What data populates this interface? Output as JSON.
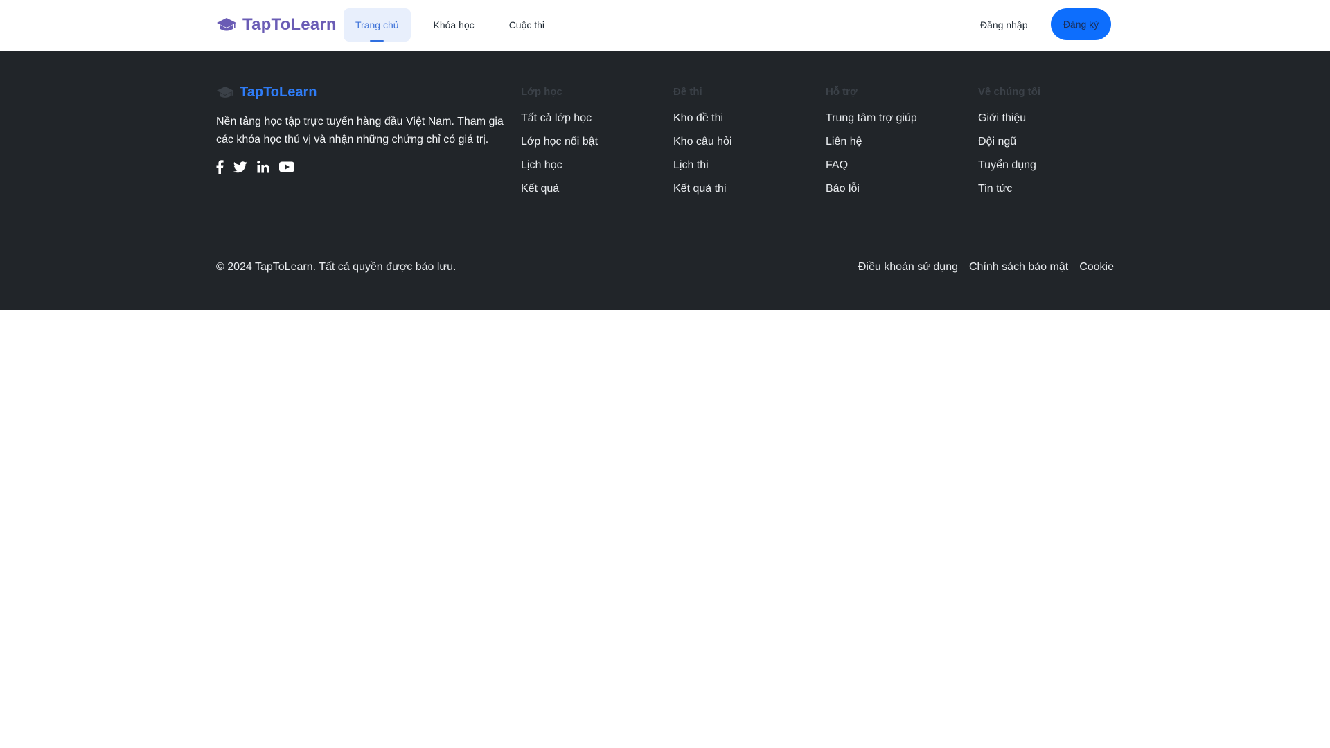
{
  "brand": {
    "name": "TapToLearn",
    "icon": "graduation-cap-icon",
    "color": "#6a5cb5"
  },
  "nav": {
    "items": [
      {
        "label": "Trang chủ",
        "active": true
      },
      {
        "label": "Khóa học",
        "active": false
      },
      {
        "label": "Cuộc thi",
        "active": false
      }
    ]
  },
  "auth": {
    "login_label": "Đăng nhập",
    "signup_label": "Đăng ký",
    "signup_color": "#0d6efd"
  },
  "footer": {
    "brand_name": "TapToLearn",
    "brand_color": "#2f7cf6",
    "background": "#212529",
    "description": "Nền tảng học tập trực tuyến hàng đầu Việt Nam. Tham gia các khóa học thú vị và nhận những chứng chỉ có giá trị.",
    "socials": [
      "facebook-icon",
      "twitter-icon",
      "linkedin-icon",
      "youtube-icon"
    ],
    "columns": [
      {
        "title": "Lớp học",
        "links": [
          "Tất cả lớp học",
          "Lớp học nổi bật",
          "Lịch học",
          "Kết quả"
        ]
      },
      {
        "title": "Đề thi",
        "links": [
          "Kho đề thi",
          "Kho câu hỏi",
          "Lịch thi",
          "Kết quả thi"
        ]
      },
      {
        "title": "Hỗ trợ",
        "links": [
          "Trung tâm trợ giúp",
          "Liên hệ",
          "FAQ",
          "Báo lỗi"
        ]
      },
      {
        "title": "Về chúng tôi",
        "links": [
          "Giới thiệu",
          "Đội ngũ",
          "Tuyển dụng",
          "Tin tức"
        ]
      }
    ],
    "copyright": "© 2024 TapToLearn. Tất cả quyền được bảo lưu.",
    "legal_links": [
      "Điều khoản sử dụng",
      "Chính sách bảo mật",
      "Cookie"
    ]
  }
}
